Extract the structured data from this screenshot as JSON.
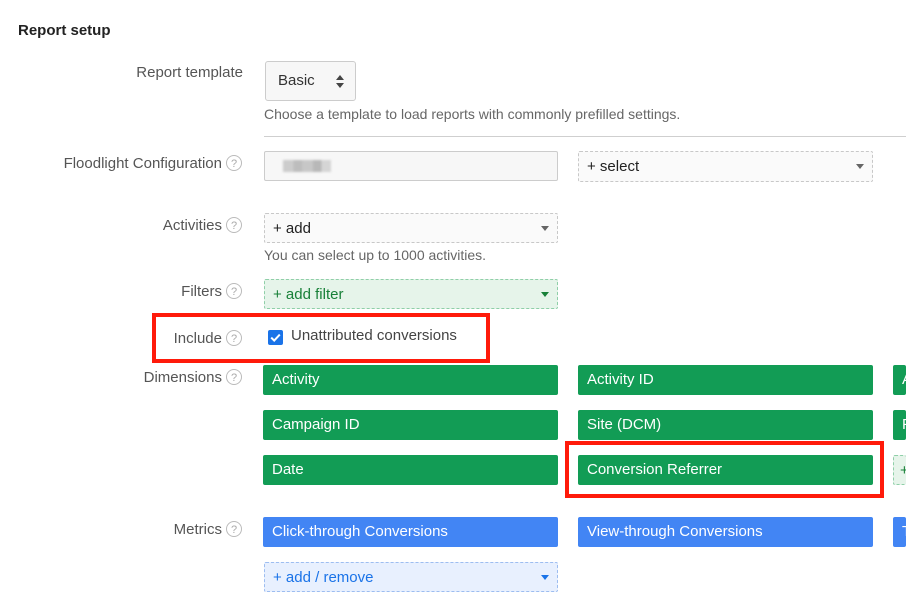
{
  "section_title": "Report setup",
  "template": {
    "label": "Report template",
    "value": "Basic",
    "hint": "Choose a template to load reports with commonly prefilled settings."
  },
  "floodlight": {
    "label": "Floodlight Configuration",
    "help": "?",
    "select_label": "+ select"
  },
  "activities": {
    "label": "Activities",
    "help": "?",
    "add_label": "+ add",
    "hint": "You can select up to 1000 activities."
  },
  "filters": {
    "label": "Filters",
    "help": "?",
    "add_label": "+ add filter"
  },
  "include": {
    "label": "Include",
    "help": "?",
    "checkbox_label": "Unattributed conversions",
    "checked": true
  },
  "dimensions": {
    "label": "Dimensions",
    "help": "?",
    "col1": [
      "Activity",
      "Campaign ID",
      "Date"
    ],
    "col2": [
      "Activity ID",
      "Site (DCM)",
      "Conversion Referrer"
    ],
    "col3_partial": [
      "A",
      "P",
      "+"
    ]
  },
  "metrics": {
    "label": "Metrics",
    "help": "?",
    "items": [
      "Click-through Conversions",
      "View-through Conversions"
    ],
    "partial": "T",
    "add_label": "+ add / remove"
  },
  "colors": {
    "dimension_chip": "#129c55",
    "metric_chip": "#4285f4",
    "highlight": "#ff1a0a"
  }
}
